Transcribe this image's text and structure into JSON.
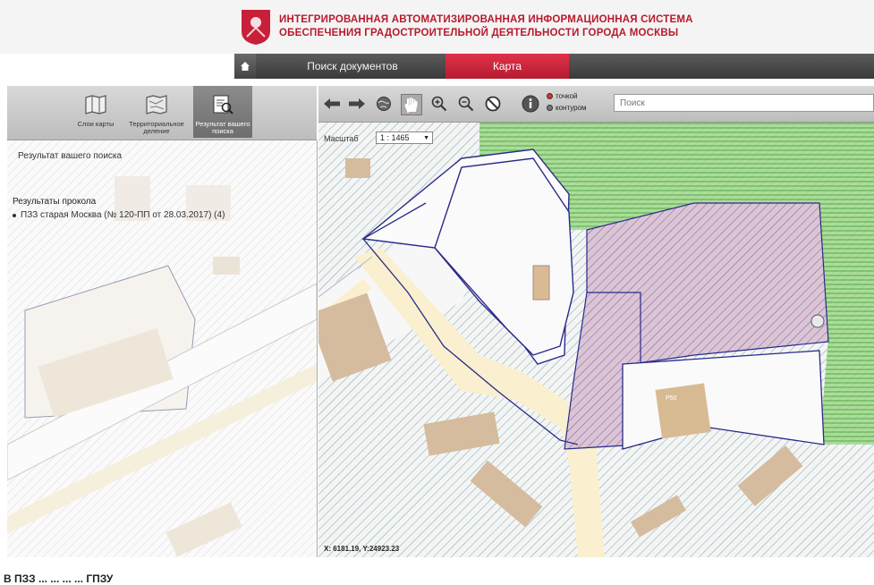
{
  "header": {
    "title_line1": "ИНТЕГРИРОВАННАЯ АВТОМАТИЗИРОВАННАЯ ИНФОРМАЦИОННАЯ СИСТЕМА",
    "title_line2": "ОБЕСПЕЧЕНИЯ ГРАДОСТРОИТЕЛЬНОЙ ДЕЯТЕЛЬНОСТИ ГОРОДА МОСКВЫ"
  },
  "nav": {
    "home_icon": "home-icon",
    "tabs": [
      {
        "label": "Поиск документов",
        "active": false
      },
      {
        "label": "Карта",
        "active": true
      }
    ]
  },
  "left_toolbar": {
    "tools": [
      {
        "label": "Слои карты",
        "icon": "map-layers-icon"
      },
      {
        "label": "Территориальное деление",
        "icon": "territory-map-icon"
      },
      {
        "label": "Результат вашего поиска",
        "icon": "search-result-icon"
      }
    ]
  },
  "map_toolbar": {
    "icons": [
      "arrow-left-icon",
      "arrow-right-icon",
      "globe-icon",
      "hand-pan-icon",
      "zoom-in-icon",
      "zoom-out-icon",
      "forbidden-icon",
      "info-icon"
    ],
    "radio_point": "точкой",
    "radio_contour": "контуром",
    "search_placeholder": "Поиск"
  },
  "left_panel": {
    "search_result_title": "Результат вашего поиска",
    "results_heading": "Результаты прокола",
    "result_items": [
      "ПЗЗ старая Москва (№ 120-ПП от 28.03.2017) (4)"
    ]
  },
  "map": {
    "scale_label": "Масштаб",
    "scale_value": "1 : 1465",
    "coords": "X: 6181.19, Y:24923.23",
    "building_label": "Р50"
  },
  "footer": {
    "text": "В ПЗЗ ... ... ... ... ГПЗУ"
  },
  "colors": {
    "accent_red": "#c8203a",
    "nav_dark": "#4a4a4a",
    "zone_purple": "#c9b3c6",
    "zone_green": "#7fc96a",
    "parcel_line": "#2a2a8a"
  }
}
